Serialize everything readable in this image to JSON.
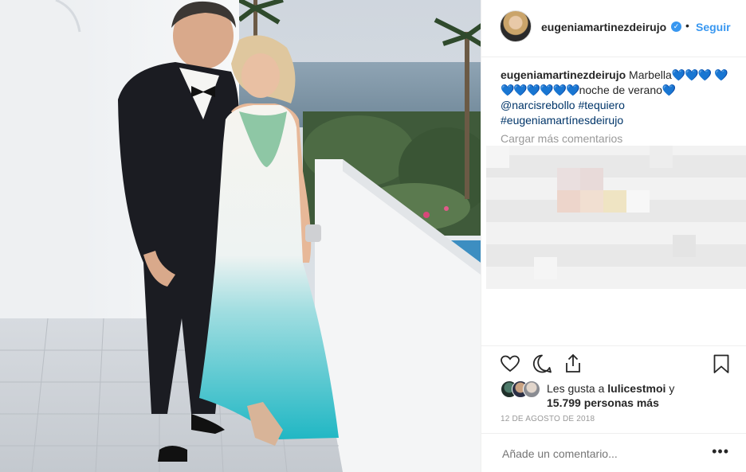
{
  "post": {
    "username": "eugeniamartinezdeirujo",
    "follow_label": "Seguir",
    "separator": "•",
    "verified_mark": "✓",
    "caption": {
      "username": "eugeniamartinezdeirujo",
      "text_1": "Marbella",
      "hearts_1": "💙💙💙",
      "hearts_2": "💙💙💙💙💙💙💙",
      "text_2": "noche de verano",
      "hearts_3": "💙",
      "mention": "@narcisrebollo",
      "hashtag_1": "#tequiero",
      "hashtag_2": "#eugeniamartínesdeirujo"
    },
    "load_more_label": "Cargar más comentarios",
    "likes": {
      "prefix": "Les gusta a",
      "user": "lulicestmoi",
      "connector": "y",
      "count": "15.799 personas más"
    },
    "date": "12 DE AGOSTO DE 2018",
    "comment_placeholder": "Añade un comentario...",
    "more_label": "•••"
  },
  "icons": {
    "like": "heart-icon",
    "comment": "comment-icon",
    "share": "share-icon",
    "save": "bookmark-icon",
    "verified": "verified-badge-icon",
    "more": "more-options-icon"
  },
  "colors": {
    "accent": "#3897f0",
    "link": "#003569",
    "muted": "#999999",
    "text": "#262626",
    "dress_top": "#f5f3ef",
    "dress_bottom": "#2bbcc6"
  }
}
